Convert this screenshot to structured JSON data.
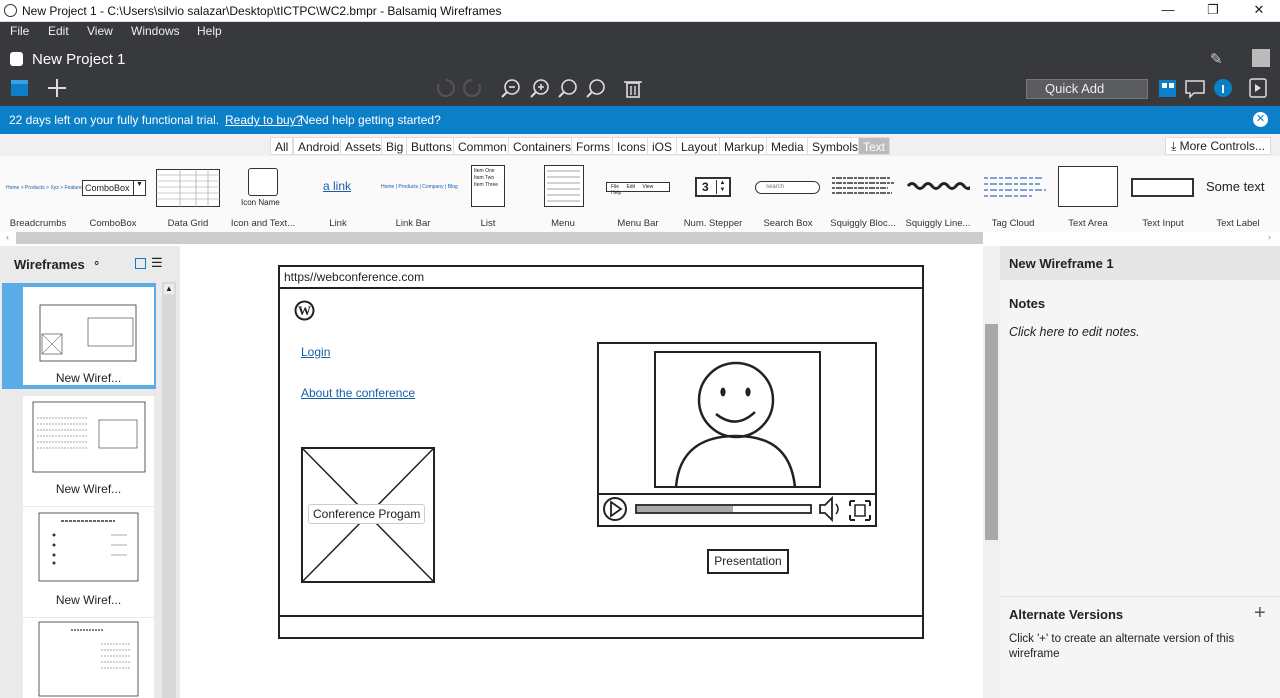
{
  "window": {
    "title": "New Project 1 - C:\\Users\\silvio salazar\\Desktop\\tICTPC\\WC2.bmpr - Balsamiq Wireframes"
  },
  "menu": [
    "File",
    "Edit",
    "View",
    "Windows",
    "Help"
  ],
  "project": {
    "title": "New Project 1"
  },
  "toolbar": {
    "quick_add": "Quick Add"
  },
  "banner": {
    "trial_text": "22 days left on your fully functional trial.",
    "buy_link": "Ready to buy?",
    "help_text": "Need help getting started?"
  },
  "library": {
    "tabs": [
      "All",
      "Android",
      "Assets",
      "Big",
      "Buttons",
      "Common",
      "Containers",
      "Forms",
      "Icons",
      "iOS",
      "Layout",
      "Markup",
      "Media",
      "Symbols",
      "Text"
    ],
    "selected_tab": "Text",
    "more_controls": "More Controls...",
    "items": [
      "Breadcrumbs",
      "ComboBox",
      "Data Grid",
      "Icon and Text...",
      "Link",
      "Link Bar",
      "List",
      "Menu",
      "Menu Bar",
      "Num. Stepper",
      "Search Box",
      "Squiggly Bloc...",
      "Squiggly Line...",
      "Tag Cloud",
      "Text Area",
      "Text Input",
      "Text Label"
    ],
    "previews": {
      "combobox": "ComboBox",
      "icon_name": "Icon Name",
      "link": "a link",
      "stepper": "3",
      "search": "search",
      "text_label": "Some text",
      "list": [
        "Item One",
        "Item Two",
        "Item Three"
      ]
    }
  },
  "wireframes": {
    "label": "Wireframes",
    "items": [
      "New Wiref...",
      "New Wiref...",
      "New Wiref..."
    ]
  },
  "canvas": {
    "url": "https//webconference.com",
    "login": "Login",
    "about": "About the conference",
    "program": "Conference Progam",
    "presentation": "Presentation"
  },
  "right_panel": {
    "title": "New Wireframe 1",
    "notes_label": "Notes",
    "notes_placeholder": "Click here to edit notes.",
    "alt_label": "Alternate Versions",
    "alt_text": "Click '+' to create an alternate version of this wireframe"
  }
}
